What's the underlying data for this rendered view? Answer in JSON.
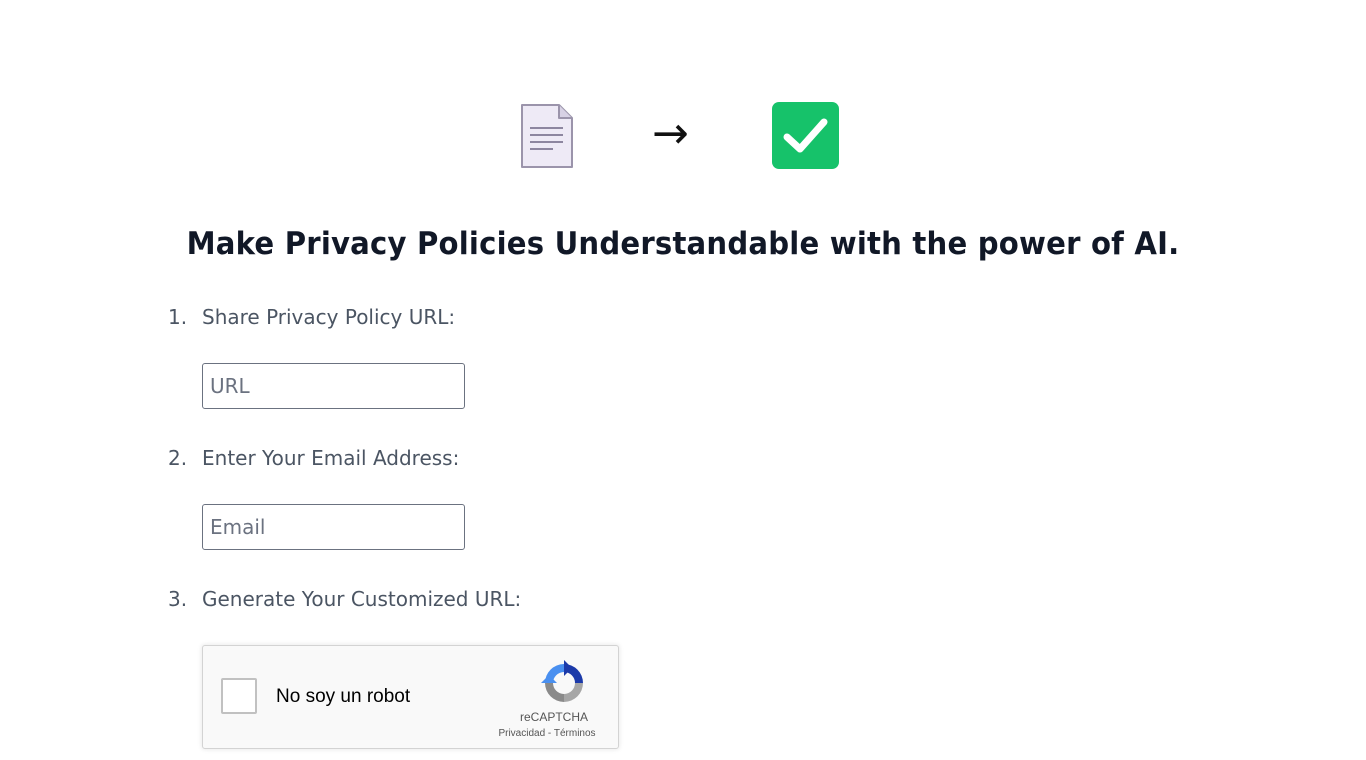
{
  "hero": {
    "doc_icon": "document-icon",
    "arrow": "→",
    "check_icon": "check-box-icon",
    "check_color": "#16c26a",
    "doc_color": "#eeeaf6"
  },
  "title": "Make Privacy Policies Understandable with the power of AI.",
  "steps": [
    {
      "number": "1.",
      "label": "Share Privacy Policy URL:"
    },
    {
      "number": "2.",
      "label": "Enter Your Email Address:"
    },
    {
      "number": "3.",
      "label": "Generate Your Customized URL:"
    }
  ],
  "url_field": {
    "placeholder": "URL",
    "value": ""
  },
  "email_field": {
    "placeholder": "Email",
    "value": ""
  },
  "recaptcha": {
    "label": "No soy un robot",
    "brand": "reCAPTCHA",
    "privacy": "Privacidad",
    "separator": " - ",
    "terms": "Términos",
    "icon": "recaptcha-logo-icon"
  }
}
